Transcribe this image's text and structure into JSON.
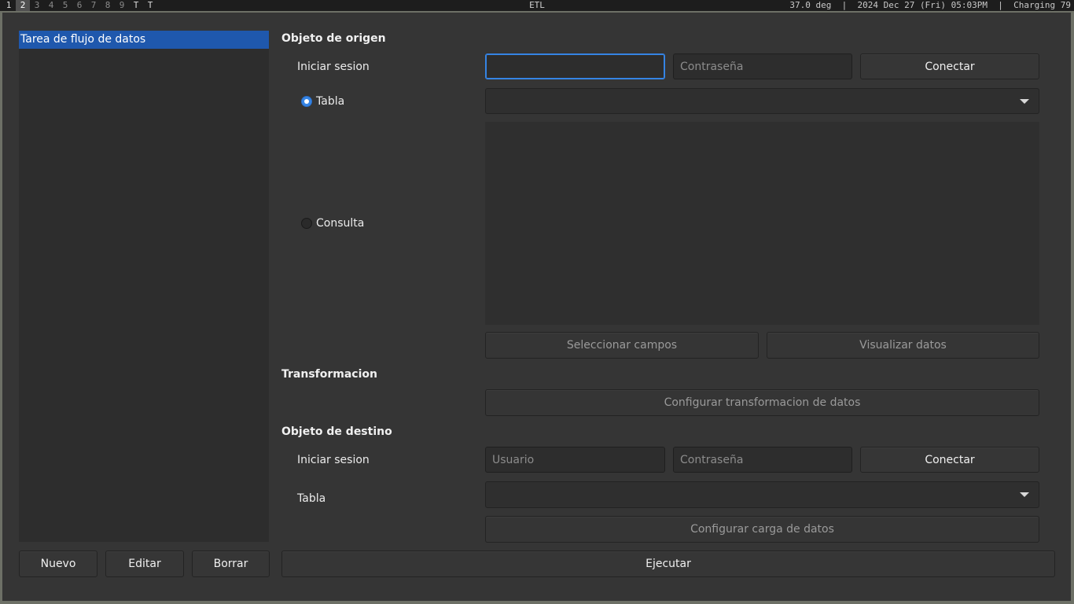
{
  "statusbar": {
    "workspaces": [
      "1",
      "2",
      "3",
      "4",
      "5",
      "6",
      "7",
      "8",
      "9",
      "T",
      "T"
    ],
    "active_workspace": "2",
    "title": "ETL",
    "right_text": "37.0 deg  |  2024 Dec 27 (Fri) 05:03PM  |  Charging 79"
  },
  "sidebar": {
    "tasks": [
      "Tarea de flujo de datos"
    ],
    "buttons": {
      "new": "Nuevo",
      "edit": "Editar",
      "delete": "Borrar"
    }
  },
  "source": {
    "title": "Objeto de origen",
    "login_label": "Iniciar sesion",
    "user_value": "",
    "user_placeholder": "",
    "password_placeholder": "Contraseña",
    "connect": "Conectar",
    "table_option": "Tabla",
    "table_selected": true,
    "table_value": "",
    "query_option": "Consulta",
    "query_selected": false,
    "select_fields": "Seleccionar campos",
    "view_data": "Visualizar datos"
  },
  "transform": {
    "title": "Transformacion",
    "configure": "Configurar transformacion de datos"
  },
  "destination": {
    "title": "Objeto de destino",
    "login_label": "Iniciar sesion",
    "user_placeholder": "Usuario",
    "password_placeholder": "Contraseña",
    "connect": "Conectar",
    "table_label": "Tabla",
    "table_value": "",
    "configure_load": "Configurar carga de datos"
  },
  "run": "Ejecutar",
  "colors": {
    "selection": "#1f58ad",
    "radio_accent": "#3584e4",
    "window_bg": "#353535"
  }
}
